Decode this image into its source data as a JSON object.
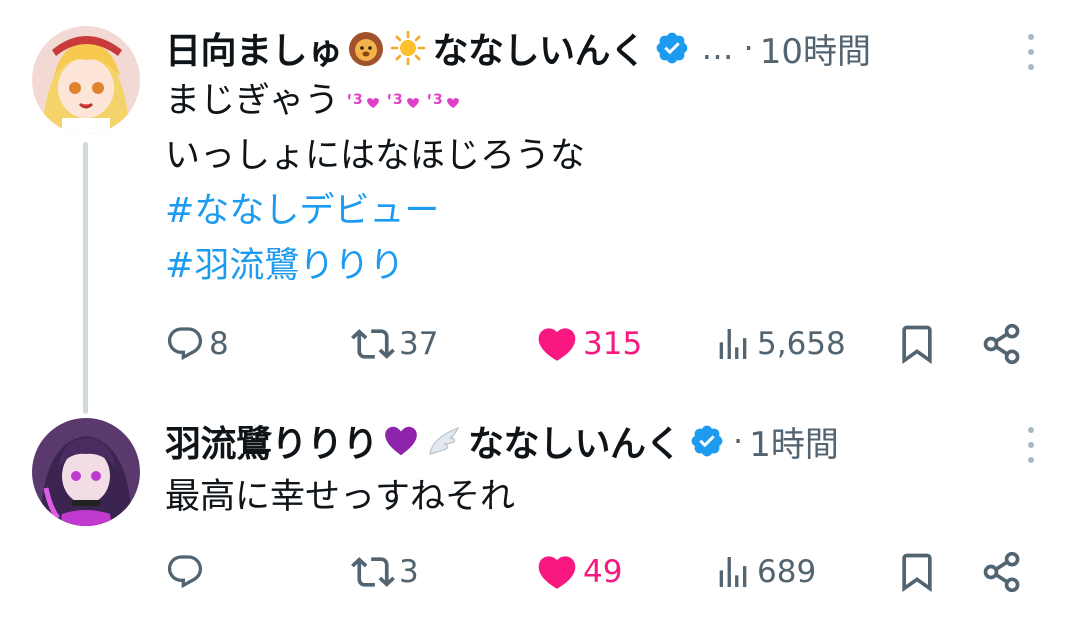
{
  "tweets": [
    {
      "display_name": "日向ましゅ",
      "name_emojis": [
        "lion-face-emoji",
        "sun-emoji"
      ],
      "handle_name": "ななしいんく",
      "ellipsis": "…",
      "separator": "·",
      "time": "10時間",
      "lines": [
        "まじぎゃう",
        "いっしょにはなほじろうな"
      ],
      "hashtags": [
        "#ななしデビュー",
        "#羽流鷺りりり"
      ],
      "stats": {
        "replies": "8",
        "retweets": "37",
        "likes": "315",
        "views": "5,658"
      },
      "liked": true
    },
    {
      "display_name": "羽流鷺りりり",
      "name_emojis": [
        "purple-heart-emoji",
        "wing-emoji"
      ],
      "handle_name": "ななしいんく",
      "separator": "·",
      "time": "1時間",
      "lines": [
        "最高に幸せっすねそれ"
      ],
      "stats": {
        "replies": "",
        "retweets": "3",
        "likes": "49",
        "views": "689"
      },
      "liked": true
    }
  ],
  "colors": {
    "accent": "#1d9bf0",
    "like": "#f91880",
    "muted": "#536471",
    "thread_line": "#cfd9de",
    "kiss_emoji": "#e040c8"
  }
}
